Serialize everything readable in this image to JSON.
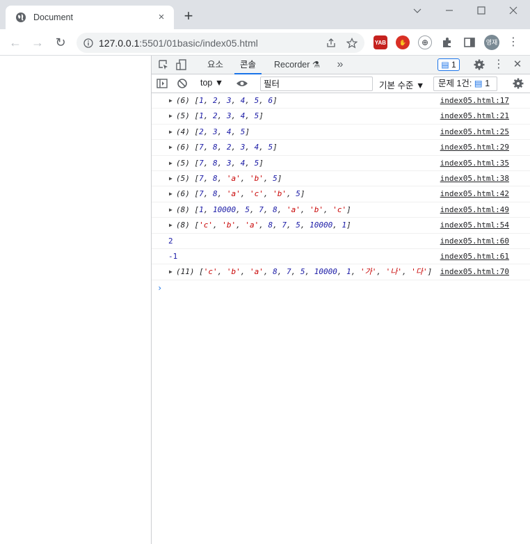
{
  "browser": {
    "tab_title": "Document",
    "new_tab_label": "+",
    "url_host": "127.0.0.1",
    "url_rest": ":5501/01basic/index05.html",
    "window_controls": {
      "minimize": "⌄",
      "restore": "—",
      "maximize": "☐",
      "close": "✕"
    },
    "ext_yab_label": "YAB",
    "avatar_label": "영재"
  },
  "devtools": {
    "tabs": [
      "요소",
      "콘솔",
      "Recorder"
    ],
    "active_tab": "콘솔",
    "issue_count": "1",
    "context": "top ▼",
    "filter_placeholder": "필터",
    "level": "기본 수준 ▼",
    "issues_label": "문제 1건:",
    "issues_count": "1"
  },
  "console_logs": [
    {
      "expandable": true,
      "text": "(6) [1, 2, 3, 4, 5, 6]",
      "source": "index05.html:17"
    },
    {
      "expandable": true,
      "text": "(5) [1, 2, 3, 4, 5]",
      "source": "index05.html:21"
    },
    {
      "expandable": true,
      "text": "(4) [2, 3, 4, 5]",
      "source": "index05.html:25"
    },
    {
      "expandable": true,
      "text": "(6) [7, 8, 2, 3, 4, 5]",
      "source": "index05.html:29"
    },
    {
      "expandable": true,
      "text": "(5) [7, 8, 3, 4, 5]",
      "source": "index05.html:35"
    },
    {
      "expandable": true,
      "text": "(5) [7, 8, 'a', 'b', 5]",
      "source": "index05.html:38"
    },
    {
      "expandable": true,
      "text": "(6) [7, 8, 'a', 'c', 'b', 5]",
      "source": "index05.html:42"
    },
    {
      "expandable": true,
      "text": "(8) [1, 10000, 5, 7, 8, 'a', 'b', 'c']",
      "source": "index05.html:49"
    },
    {
      "expandable": true,
      "text": "(8) ['c', 'b', 'a', 8, 7, 5, 10000, 1]",
      "source": "index05.html:54"
    },
    {
      "expandable": false,
      "text": "2",
      "source": "index05.html:60"
    },
    {
      "expandable": false,
      "text": "-1",
      "source": "index05.html:61"
    },
    {
      "expandable": true,
      "text": "(11) ['c', 'b', 'a', 8, 7, 5, 10000, 1, '가', '나', '다']",
      "source": "index05.html:70"
    }
  ],
  "prompt_symbol": "›",
  "colors": {
    "accent": "#1a73e8",
    "number": "#1a1aa6",
    "string": "#c80000"
  }
}
